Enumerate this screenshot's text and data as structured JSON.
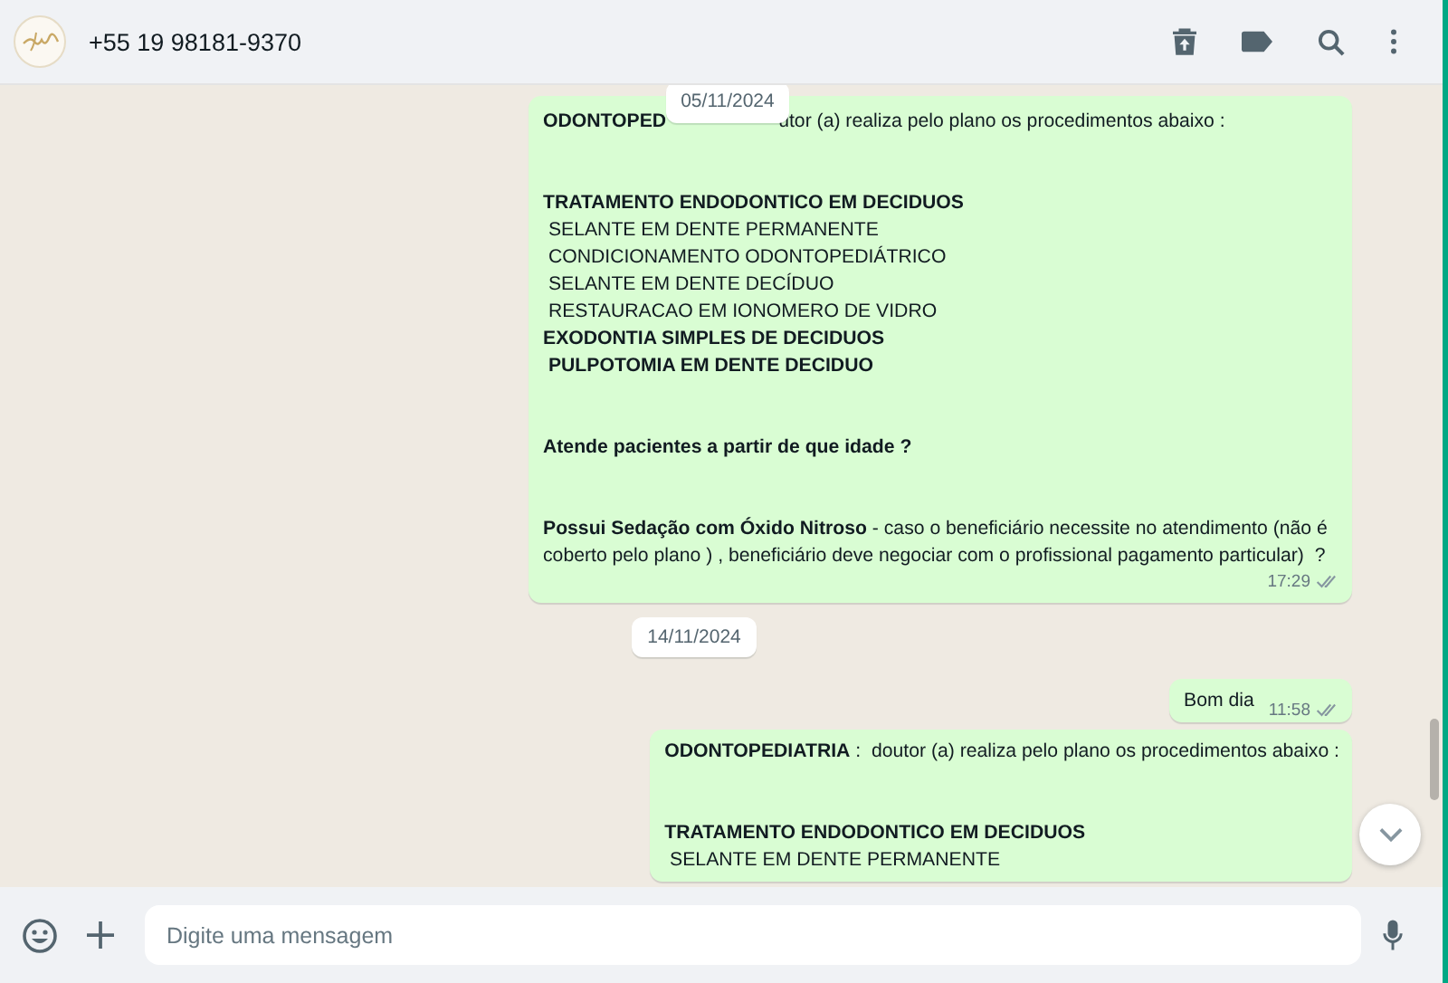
{
  "header": {
    "contact": "+55 19 98181-9370"
  },
  "sticky_date": "05/11/2024",
  "messages": [
    {
      "kind": "bubble",
      "time": "17:29",
      "read": false,
      "paragraphs": [
        [
          {
            "text": "ODONTOPED",
            "bold": true,
            "after_cover": "utor (a) realiza pelo plano os procedimentos abaixo :"
          }
        ],
        [
          {
            "text": "TRATAMENTO ENDODONTICO EM DECIDUOS",
            "bold": true
          },
          {
            "text": " SELANTE EM DENTE PERMANENTE",
            "bold": false
          },
          {
            "text": " CONDICIONAMENTO ODONTOPEDIÁTRICO",
            "bold": false
          },
          {
            "text": " SELANTE EM DENTE DECÍDUO",
            "bold": false
          },
          {
            "text": " RESTAURACAO EM IONOMERO DE VIDRO",
            "bold": false
          },
          {
            "text": "EXODONTIA SIMPLES DE DECIDUOS",
            "bold": true
          },
          {
            "text": " PULPOTOMIA EM DENTE DECIDUO",
            "bold": true
          }
        ],
        [
          {
            "text": "Atende pacientes a partir de que idade ?",
            "bold": true
          }
        ],
        [
          {
            "text": "**Possui Sedação com Óxido Nitroso** - caso o beneficiário necessite no atendimento (não é coberto pelo plano ) , beneficiário deve negociar com o profissional pagamento particular)  ?",
            "bold": false
          }
        ]
      ]
    },
    {
      "kind": "date",
      "text": "14/11/2024"
    },
    {
      "kind": "bubble",
      "time": "11:58",
      "read": false,
      "paragraphs": [
        [
          {
            "text": "Bom dia",
            "bold": false
          }
        ]
      ]
    },
    {
      "kind": "bubble",
      "paragraphs": [
        [
          {
            "text": "**ODONTOPEDIATRIA** :  doutor (a) realiza pelo plano os procedimentos abaixo :",
            "bold": false
          }
        ],
        [
          {
            "text": "TRATAMENTO ENDODONTICO EM DECIDUOS",
            "bold": true
          },
          {
            "text": " SELANTE EM DENTE PERMANENTE",
            "bold": false
          }
        ]
      ]
    }
  ],
  "composer": {
    "placeholder": "Digite uma mensagem"
  }
}
